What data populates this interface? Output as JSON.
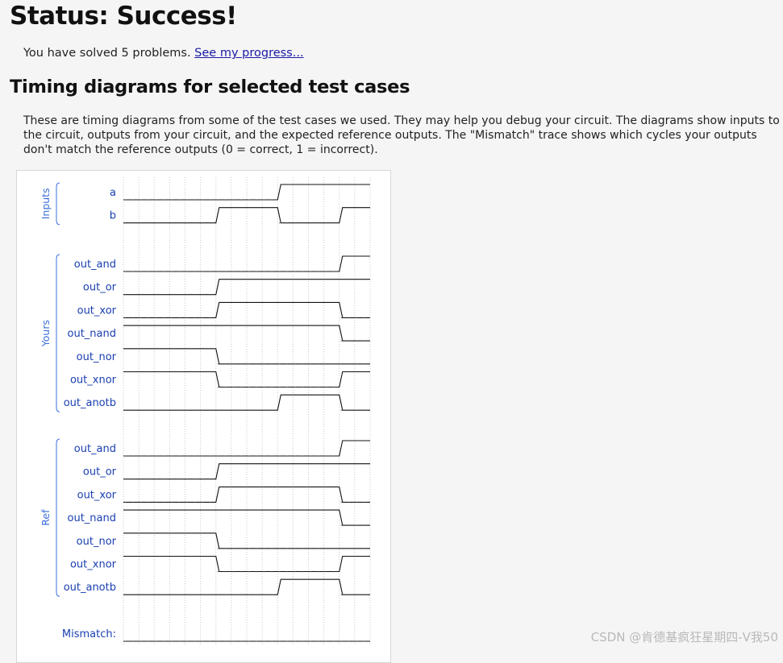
{
  "page": {
    "title": "Status: Success!",
    "solved_text": "You have solved 5 problems.",
    "progress_link": "See my progress...",
    "section_title": "Timing diagrams for selected test cases",
    "description": "These are timing diagrams from some of the test cases we used. They may help you debug your circuit. The diagrams show inputs to the circuit, outputs from your circuit, and the expected reference outputs. The \"Mismatch\" trace shows which cycles your outputs don't match the reference outputs (0 = correct, 1 = incorrect).",
    "watermark": "CSDN @肯德基疯狂星期四-V我50"
  },
  "timing": {
    "colors": {
      "label": "#1a3fb0",
      "group": "#3a6fd8",
      "wave": "#111111",
      "grid": "#c8c8c8"
    },
    "groups": [
      {
        "name": "Inputs",
        "signals": [
          {
            "label": "a",
            "values": [
              0,
              0,
              0,
              0,
              0,
              1,
              1,
              1
            ]
          },
          {
            "label": "b",
            "values": [
              0,
              0,
              0,
              1,
              1,
              0,
              0,
              1
            ]
          }
        ]
      },
      {
        "name": "Yours",
        "signals": [
          {
            "label": "out_and",
            "values": [
              0,
              0,
              0,
              0,
              0,
              0,
              0,
              1
            ]
          },
          {
            "label": "out_or",
            "values": [
              0,
              0,
              0,
              1,
              1,
              1,
              1,
              1
            ]
          },
          {
            "label": "out_xor",
            "values": [
              0,
              0,
              0,
              1,
              1,
              1,
              1,
              0
            ]
          },
          {
            "label": "out_nand",
            "values": [
              1,
              1,
              1,
              1,
              1,
              1,
              1,
              0
            ]
          },
          {
            "label": "out_nor",
            "values": [
              1,
              1,
              1,
              0,
              0,
              0,
              0,
              0
            ]
          },
          {
            "label": "out_xnor",
            "values": [
              1,
              1,
              1,
              0,
              0,
              0,
              0,
              1
            ]
          },
          {
            "label": "out_anotb",
            "values": [
              0,
              0,
              0,
              0,
              0,
              1,
              1,
              0
            ]
          }
        ]
      },
      {
        "name": "Ref",
        "signals": [
          {
            "label": "out_and",
            "values": [
              0,
              0,
              0,
              0,
              0,
              0,
              0,
              1
            ]
          },
          {
            "label": "out_or",
            "values": [
              0,
              0,
              0,
              1,
              1,
              1,
              1,
              1
            ]
          },
          {
            "label": "out_xor",
            "values": [
              0,
              0,
              0,
              1,
              1,
              1,
              1,
              0
            ]
          },
          {
            "label": "out_nand",
            "values": [
              1,
              1,
              1,
              1,
              1,
              1,
              1,
              0
            ]
          },
          {
            "label": "out_nor",
            "values": [
              1,
              1,
              1,
              0,
              0,
              0,
              0,
              0
            ]
          },
          {
            "label": "out_xnor",
            "values": [
              1,
              1,
              1,
              0,
              0,
              0,
              0,
              1
            ]
          },
          {
            "label": "out_anotb",
            "values": [
              0,
              0,
              0,
              0,
              0,
              1,
              1,
              0
            ]
          }
        ]
      }
    ],
    "mismatch": {
      "label": "Mismatch:",
      "values": [
        0,
        0,
        0,
        0,
        0,
        0,
        0,
        0
      ]
    }
  }
}
